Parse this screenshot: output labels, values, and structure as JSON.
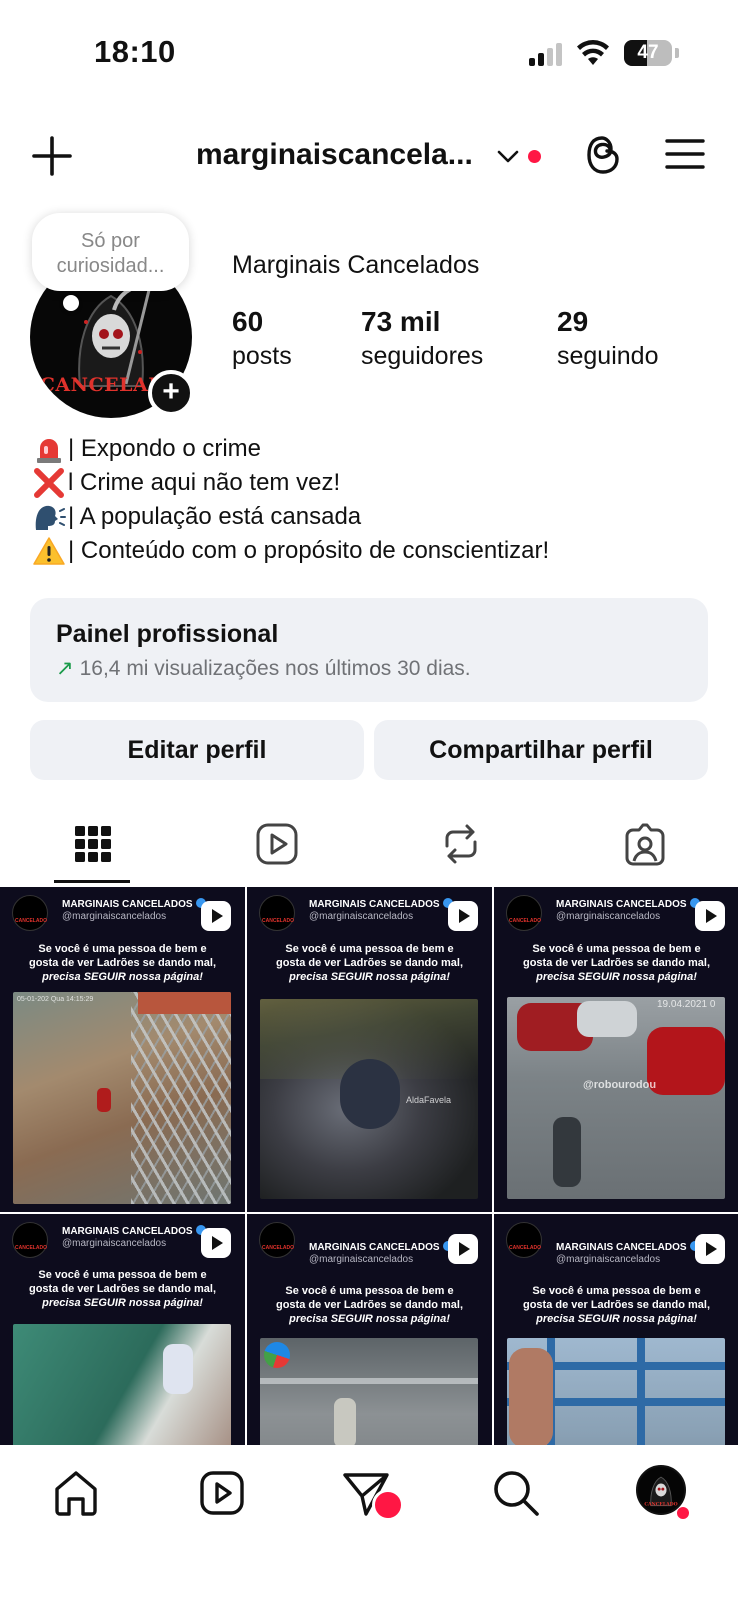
{
  "status_bar": {
    "time": "18:10",
    "battery": "47",
    "battery_level": 0.47,
    "signal_bars_active": 2
  },
  "header": {
    "username": "marginaiscancela...",
    "notification_dot_color": "#ff1744",
    "icons": [
      "plus-icon",
      "chevron-down-icon",
      "threads-icon",
      "menu-icon"
    ]
  },
  "profile": {
    "note_line1": "Só por",
    "note_line2": "curiosidad...",
    "avatar_text": "CANCELADO",
    "display_name": "Marginais Cancelados",
    "stats": [
      {
        "count": "60",
        "label": "posts"
      },
      {
        "count": "73 mil",
        "label": "seguidores"
      },
      {
        "count": "29",
        "label": "seguindo"
      }
    ],
    "bio": [
      {
        "icon": "siren-emoji",
        "text": "| Expondo o crime"
      },
      {
        "icon": "cross-mark-emoji",
        "text": "l Crime aqui não tem vez!"
      },
      {
        "icon": "speaking-head-emoji",
        "text": "| A população está cansada"
      },
      {
        "icon": "warning-emoji",
        "text": "| Conteúdo com o propósito de conscientizar!"
      }
    ]
  },
  "panel": {
    "title": "Painel profissional",
    "arrow": "↗",
    "subtitle": "16,4 mi visualizações nos últimos 30 dias.",
    "accent_color": "#1a9b4a"
  },
  "buttons": {
    "edit": "Editar perfil",
    "share": "Compartilhar perfil"
  },
  "tabs": [
    "grid-icon",
    "reels-icon",
    "reposts-icon",
    "tagged-icon"
  ],
  "posts": [
    {
      "name": "MARGINAIS CANCELADOS",
      "handle": "@marginaiscancelados",
      "line1": "Se você é uma pessoa de bem e",
      "line2": "gosta de ver Ladrões se dando mal,",
      "line3": "precisa SEGUIR nossa página!",
      "overlay": "05-01-202  Qua 14:15:29"
    },
    {
      "name": "MARGINAIS CANCELADOS",
      "handle": "@marginaiscancelados",
      "line1": "Se você é uma pessoa de bem e",
      "line2": "gosta de ver Ladrões se dando mal,",
      "line3": "precisa SEGUIR nossa página!",
      "overlay": "AldaFavela"
    },
    {
      "name": "MARGINAIS CANCELADOS",
      "handle": "@marginaiscancelados",
      "line1": "Se você é uma pessoa de bem e",
      "line2": "gosta de ver Ladrões se dando mal,",
      "line3": "precisa SEGUIR nossa página!",
      "overlay": "@robourodou",
      "date": "19.04.2021 0"
    },
    {
      "name": "MARGINAIS CANCELADOS",
      "handle": "@marginaiscancelados",
      "line1": "Se você é uma pessoa de bem e",
      "line2": "gosta de ver Ladrões se dando mal,",
      "line3": "precisa SEGUIR nossa página!",
      "overlay": ""
    },
    {
      "name": "MARGINAIS CANCELADOS",
      "handle": "@marginaiscancelados",
      "line1": "Se você é uma pessoa de bem e",
      "line2": "gosta de ver Ladrões se dando mal,",
      "line3": "precisa SEGUIR nossa página!",
      "overlay": ""
    },
    {
      "name": "MARGINAIS CANCELADOS",
      "handle": "@marginaiscancelados",
      "line1": "Se você é uma pessoa de bem e",
      "line2": "gosta de ver Ladrões se dando mal,",
      "line3": "precisa SEGUIR nossa página!",
      "overlay": ""
    }
  ],
  "bottom_nav": [
    "home-icon",
    "reels-icon",
    "messages-icon",
    "search-icon",
    "profile-avatar"
  ],
  "bottom_nav_badge_color": "#ff1744"
}
